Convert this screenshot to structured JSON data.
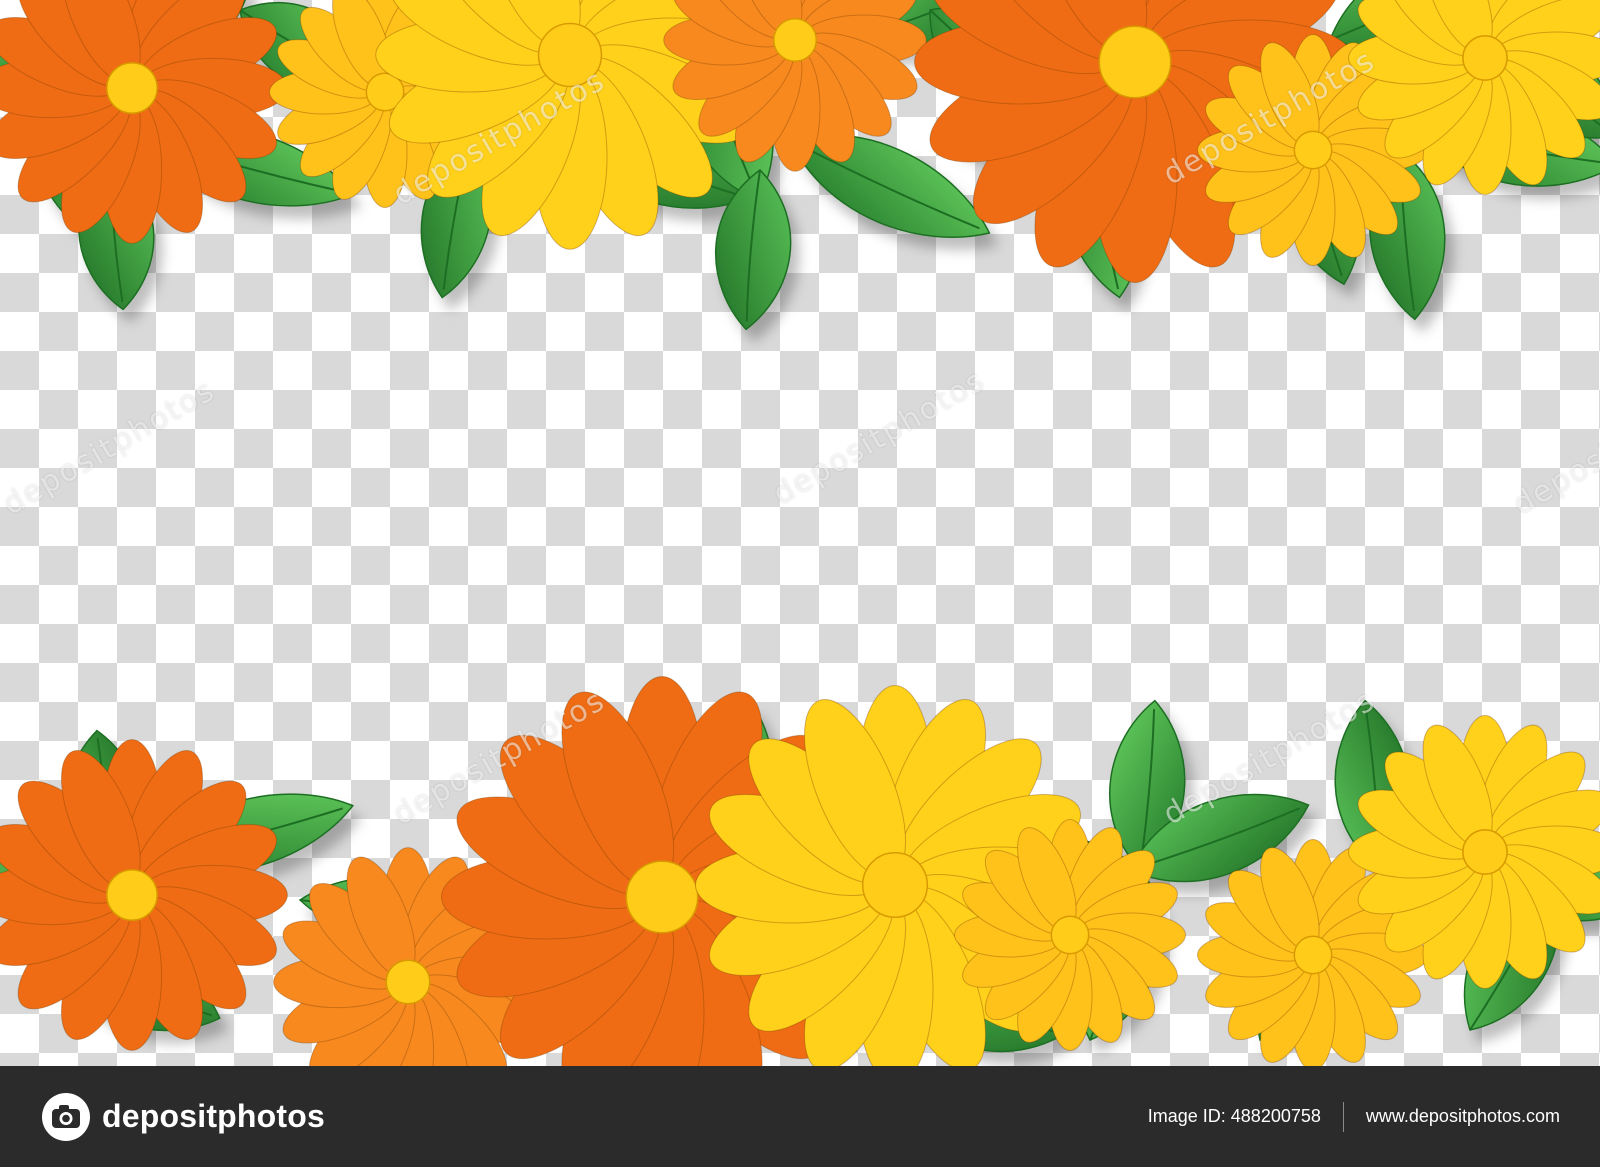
{
  "watermark": {
    "text": "depositphotos"
  },
  "footer": {
    "brand_name": "depositphotos",
    "image_id": "Image ID: 488200758",
    "site_url": "www.depositphotos.com"
  },
  "colors": {
    "checker_light": "#ffffff",
    "checker_dark": "#d9d9d9",
    "leaf_green": "#3a9a3a",
    "leaf_dark": "#1f6e24",
    "flower_orange": "#ef6c14",
    "flower_yellow": "#ffd11a",
    "flower_center": "#ffcc1a",
    "footer_bg": "#2b2b2b"
  }
}
